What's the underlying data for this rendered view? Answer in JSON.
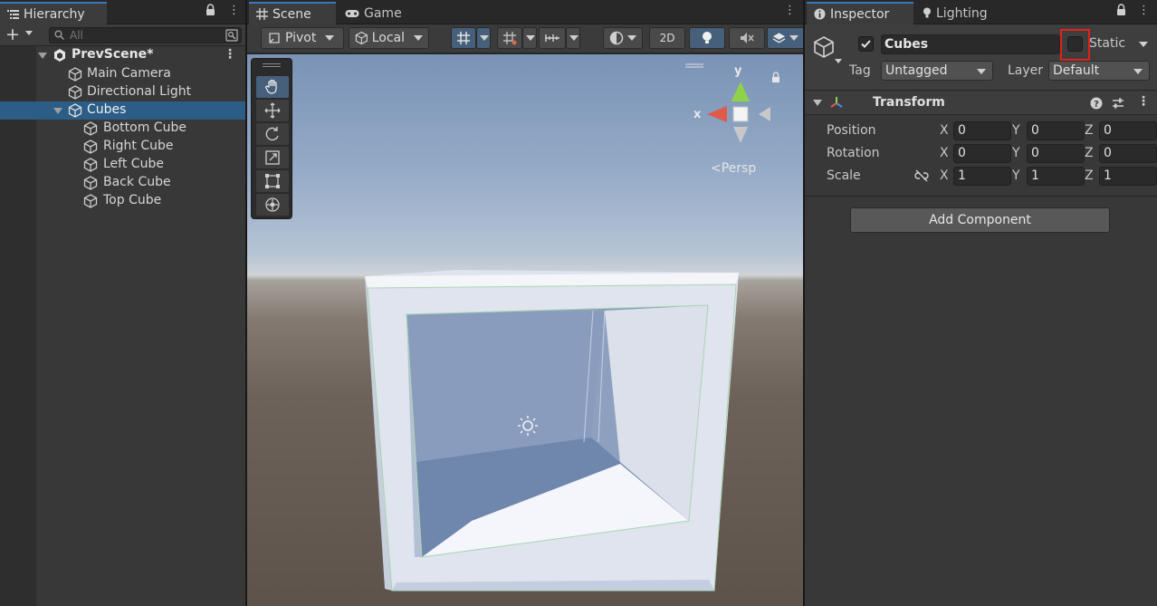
{
  "hierarchy": {
    "tab_label": "Hierarchy",
    "search_placeholder": "All",
    "scene_name": "PrevScene*",
    "items": [
      {
        "label": "Main Camera"
      },
      {
        "label": "Directional Light"
      },
      {
        "label": "Cubes"
      },
      {
        "label": "Bottom Cube"
      },
      {
        "label": "Right Cube"
      },
      {
        "label": "Left Cube"
      },
      {
        "label": "Back Cube"
      },
      {
        "label": "Top Cube"
      }
    ]
  },
  "scene": {
    "tabs": [
      {
        "label": "Scene"
      },
      {
        "label": "Game"
      }
    ],
    "toolbar": {
      "pivot": "Pivot",
      "space": "Local",
      "mode_2d": "2D"
    },
    "gizmo": {
      "y": "y",
      "x": "x",
      "projection": "Persp"
    }
  },
  "inspector": {
    "tabs": [
      {
        "label": "Inspector"
      },
      {
        "label": "Lighting"
      }
    ],
    "object_name": "Cubes",
    "active": true,
    "static_label": "Static",
    "static_checked": false,
    "tag_label": "Tag",
    "tag_value": "Untagged",
    "layer_label": "Layer",
    "layer_value": "Default",
    "component_title": "Transform",
    "transform": {
      "position": {
        "label": "Position",
        "x": "0",
        "y": "0",
        "z": "0"
      },
      "rotation": {
        "label": "Rotation",
        "x": "0",
        "y": "0",
        "z": "0"
      },
      "scale": {
        "label": "Scale",
        "x": "1",
        "y": "1",
        "z": "1"
      }
    },
    "axis_labels": {
      "x": "X",
      "y": "Y",
      "z": "Z"
    },
    "add_component_label": "Add Component"
  },
  "colors": {
    "selection": "#2c5d87",
    "active_tab_accent": "#3a79bb",
    "highlight": "#e32119",
    "gizmo_y": "#8ed24a",
    "gizmo_x": "#e05a4a"
  }
}
